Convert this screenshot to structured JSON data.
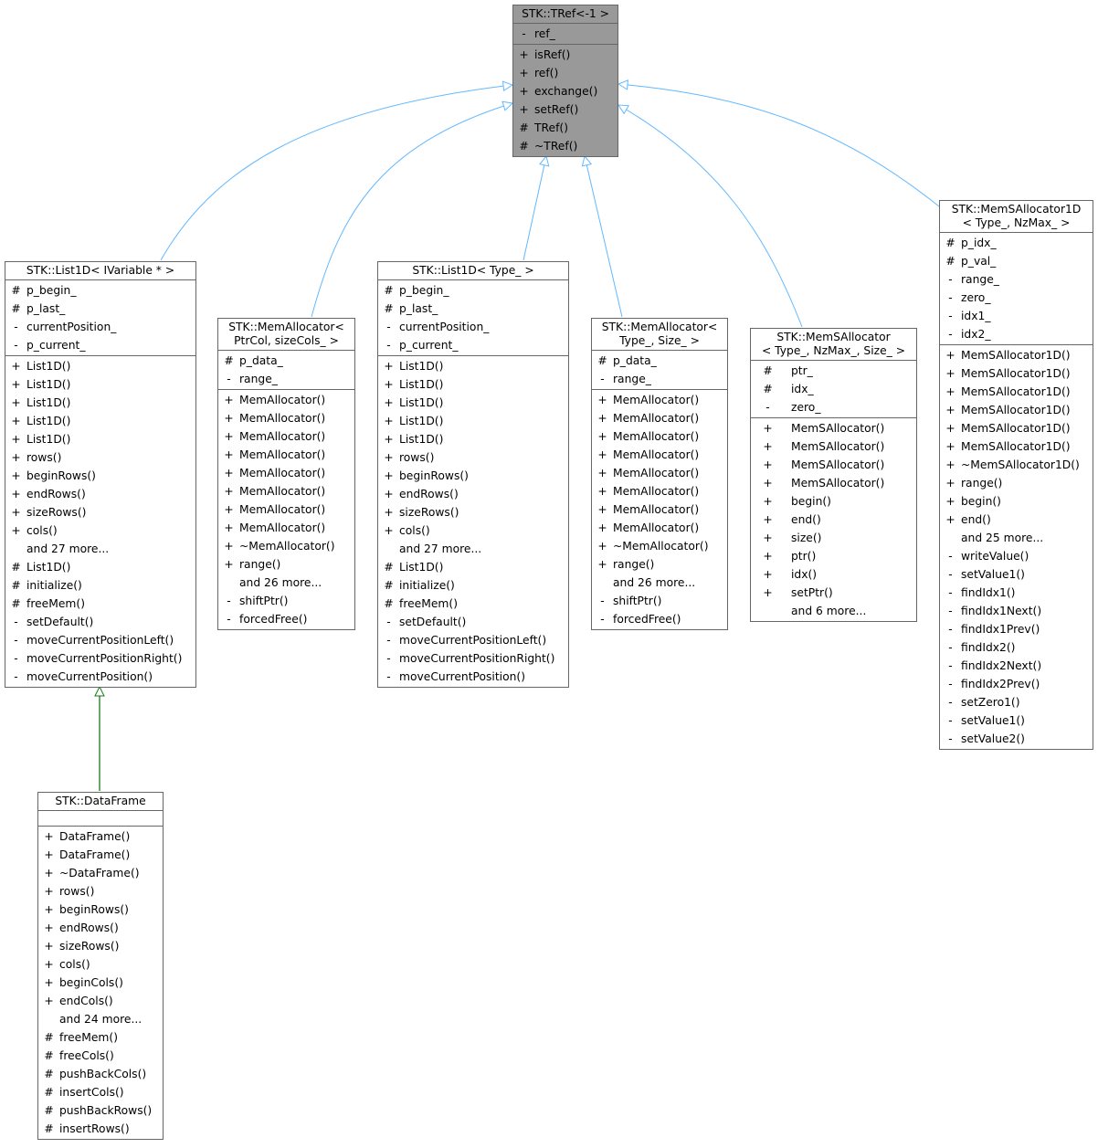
{
  "diagram": {
    "edge_colors": {
      "inherit_public": "#63b8ff",
      "inherit_derived": "#1a7a1a"
    },
    "classes": {
      "tref": {
        "title": [
          "STK::TRef<-1 >"
        ],
        "attributes": [
          [
            "-",
            "ref_"
          ]
        ],
        "methods": [
          [
            "+",
            "isRef()"
          ],
          [
            "+",
            "ref()"
          ],
          [
            "+",
            "exchange()"
          ],
          [
            "+",
            "setRef()"
          ],
          [
            "#",
            "TRef()"
          ],
          [
            "#",
            "~TRef()"
          ]
        ]
      },
      "list1d_ivar": {
        "title": [
          "STK::List1D< IVariable * >"
        ],
        "attributes": [
          [
            "#",
            "p_begin_"
          ],
          [
            "#",
            "p_last_"
          ],
          [
            "-",
            "currentPosition_"
          ],
          [
            "-",
            "p_current_"
          ]
        ],
        "methods": [
          [
            "+",
            "List1D()"
          ],
          [
            "+",
            "List1D()"
          ],
          [
            "+",
            "List1D()"
          ],
          [
            "+",
            "List1D()"
          ],
          [
            "+",
            "List1D()"
          ],
          [
            "+",
            "rows()"
          ],
          [
            "+",
            "beginRows()"
          ],
          [
            "+",
            "endRows()"
          ],
          [
            "+",
            "sizeRows()"
          ],
          [
            "+",
            "cols()"
          ],
          [
            "",
            "and 27 more..."
          ],
          [
            "#",
            "List1D()"
          ],
          [
            "#",
            "initialize()"
          ],
          [
            "#",
            "freeMem()"
          ],
          [
            "-",
            "setDefault()"
          ],
          [
            "-",
            "moveCurrentPositionLeft()"
          ],
          [
            "-",
            "moveCurrentPositionRight()"
          ],
          [
            "-",
            "moveCurrentPosition()"
          ]
        ]
      },
      "memalloc_ptrcol": {
        "title": [
          "STK::MemAllocator<",
          "PtrCol, sizeCols_ >"
        ],
        "attributes": [
          [
            "#",
            "p_data_"
          ],
          [
            "-",
            "range_"
          ]
        ],
        "methods": [
          [
            "+",
            "MemAllocator()"
          ],
          [
            "+",
            "MemAllocator()"
          ],
          [
            "+",
            "MemAllocator()"
          ],
          [
            "+",
            "MemAllocator()"
          ],
          [
            "+",
            "MemAllocator()"
          ],
          [
            "+",
            "MemAllocator()"
          ],
          [
            "+",
            "MemAllocator()"
          ],
          [
            "+",
            "MemAllocator()"
          ],
          [
            "+",
            "~MemAllocator()"
          ],
          [
            "+",
            "range()"
          ],
          [
            "",
            "and 26 more..."
          ],
          [
            "-",
            "shiftPtr()"
          ],
          [
            "-",
            "forcedFree()"
          ]
        ]
      },
      "list1d_type": {
        "title": [
          "STK::List1D< Type_ >"
        ],
        "attributes": [
          [
            "#",
            "p_begin_"
          ],
          [
            "#",
            "p_last_"
          ],
          [
            "-",
            "currentPosition_"
          ],
          [
            "-",
            "p_current_"
          ]
        ],
        "methods": [
          [
            "+",
            "List1D()"
          ],
          [
            "+",
            "List1D()"
          ],
          [
            "+",
            "List1D()"
          ],
          [
            "+",
            "List1D()"
          ],
          [
            "+",
            "List1D()"
          ],
          [
            "+",
            "rows()"
          ],
          [
            "+",
            "beginRows()"
          ],
          [
            "+",
            "endRows()"
          ],
          [
            "+",
            "sizeRows()"
          ],
          [
            "+",
            "cols()"
          ],
          [
            "",
            "and 27 more..."
          ],
          [
            "#",
            "List1D()"
          ],
          [
            "#",
            "initialize()"
          ],
          [
            "#",
            "freeMem()"
          ],
          [
            "-",
            "setDefault()"
          ],
          [
            "-",
            "moveCurrentPositionLeft()"
          ],
          [
            "-",
            "moveCurrentPositionRight()"
          ],
          [
            "-",
            "moveCurrentPosition()"
          ]
        ]
      },
      "memalloc_type": {
        "title": [
          "STK::MemAllocator<",
          "Type_, Size_ >"
        ],
        "attributes": [
          [
            "#",
            "p_data_"
          ],
          [
            "-",
            "range_"
          ]
        ],
        "methods": [
          [
            "+",
            "MemAllocator()"
          ],
          [
            "+",
            "MemAllocator()"
          ],
          [
            "+",
            "MemAllocator()"
          ],
          [
            "+",
            "MemAllocator()"
          ],
          [
            "+",
            "MemAllocator()"
          ],
          [
            "+",
            "MemAllocator()"
          ],
          [
            "+",
            "MemAllocator()"
          ],
          [
            "+",
            "MemAllocator()"
          ],
          [
            "+",
            "~MemAllocator()"
          ],
          [
            "+",
            "range()"
          ],
          [
            "",
            "and 26 more..."
          ],
          [
            "-",
            "shiftPtr()"
          ],
          [
            "-",
            "forcedFree()"
          ]
        ]
      },
      "memsalloc": {
        "title": [
          "STK::MemSAllocator",
          "< Type_, NzMax_, Size_ >"
        ],
        "attributes": [
          [
            "#",
            "ptr_"
          ],
          [
            "#",
            "idx_"
          ],
          [
            "-",
            "zero_"
          ]
        ],
        "methods": [
          [
            "+",
            "MemSAllocator()"
          ],
          [
            "+",
            "MemSAllocator()"
          ],
          [
            "+",
            "MemSAllocator()"
          ],
          [
            "+",
            "MemSAllocator()"
          ],
          [
            "+",
            "begin()"
          ],
          [
            "+",
            "end()"
          ],
          [
            "+",
            "size()"
          ],
          [
            "+",
            "ptr()"
          ],
          [
            "+",
            "idx()"
          ],
          [
            "+",
            "setPtr()"
          ],
          [
            "",
            "and 6 more..."
          ]
        ]
      },
      "memsalloc1d": {
        "title": [
          "STK::MemSAllocator1D",
          "< Type_, NzMax_ >"
        ],
        "attributes": [
          [
            "#",
            "p_idx_"
          ],
          [
            "#",
            "p_val_"
          ],
          [
            "-",
            "range_"
          ],
          [
            "-",
            "zero_"
          ],
          [
            "-",
            "idx1_"
          ],
          [
            "-",
            "idx2_"
          ]
        ],
        "methods": [
          [
            "+",
            "MemSAllocator1D()"
          ],
          [
            "+",
            "MemSAllocator1D()"
          ],
          [
            "+",
            "MemSAllocator1D()"
          ],
          [
            "+",
            "MemSAllocator1D()"
          ],
          [
            "+",
            "MemSAllocator1D()"
          ],
          [
            "+",
            "MemSAllocator1D()"
          ],
          [
            "+",
            "~MemSAllocator1D()"
          ],
          [
            "+",
            "range()"
          ],
          [
            "+",
            "begin()"
          ],
          [
            "+",
            "end()"
          ],
          [
            "",
            "and 25 more..."
          ],
          [
            "-",
            "writeValue()"
          ],
          [
            "-",
            "setValue1()"
          ],
          [
            "-",
            "findIdx1()"
          ],
          [
            "-",
            "findIdx1Next()"
          ],
          [
            "-",
            "findIdx1Prev()"
          ],
          [
            "-",
            "findIdx2()"
          ],
          [
            "-",
            "findIdx2Next()"
          ],
          [
            "-",
            "findIdx2Prev()"
          ],
          [
            "-",
            "setZero1()"
          ],
          [
            "-",
            "setValue1()"
          ],
          [
            "-",
            "setValue2()"
          ]
        ]
      },
      "dataframe": {
        "title": [
          "STK::DataFrame"
        ],
        "attributes": [],
        "methods": [
          [
            "+",
            "DataFrame()"
          ],
          [
            "+",
            "DataFrame()"
          ],
          [
            "+",
            "~DataFrame()"
          ],
          [
            "+",
            "rows()"
          ],
          [
            "+",
            "beginRows()"
          ],
          [
            "+",
            "endRows()"
          ],
          [
            "+",
            "sizeRows()"
          ],
          [
            "+",
            "cols()"
          ],
          [
            "+",
            "beginCols()"
          ],
          [
            "+",
            "endCols()"
          ],
          [
            "",
            "and 24 more..."
          ],
          [
            "#",
            "freeMem()"
          ],
          [
            "#",
            "freeCols()"
          ],
          [
            "#",
            "pushBackCols()"
          ],
          [
            "#",
            "insertCols()"
          ],
          [
            "#",
            "pushBackRows()"
          ],
          [
            "#",
            "insertRows()"
          ]
        ]
      }
    },
    "edges": [
      {
        "from": "list1d_ivar",
        "to": "tref",
        "kind": "inherit_public"
      },
      {
        "from": "memalloc_ptrcol",
        "to": "tref",
        "kind": "inherit_public"
      },
      {
        "from": "list1d_type",
        "to": "tref",
        "kind": "inherit_public"
      },
      {
        "from": "memalloc_type",
        "to": "tref",
        "kind": "inherit_public"
      },
      {
        "from": "memsalloc",
        "to": "tref",
        "kind": "inherit_public"
      },
      {
        "from": "memsalloc1d",
        "to": "tref",
        "kind": "inherit_public"
      },
      {
        "from": "dataframe",
        "to": "list1d_ivar",
        "kind": "inherit_derived"
      }
    ]
  }
}
